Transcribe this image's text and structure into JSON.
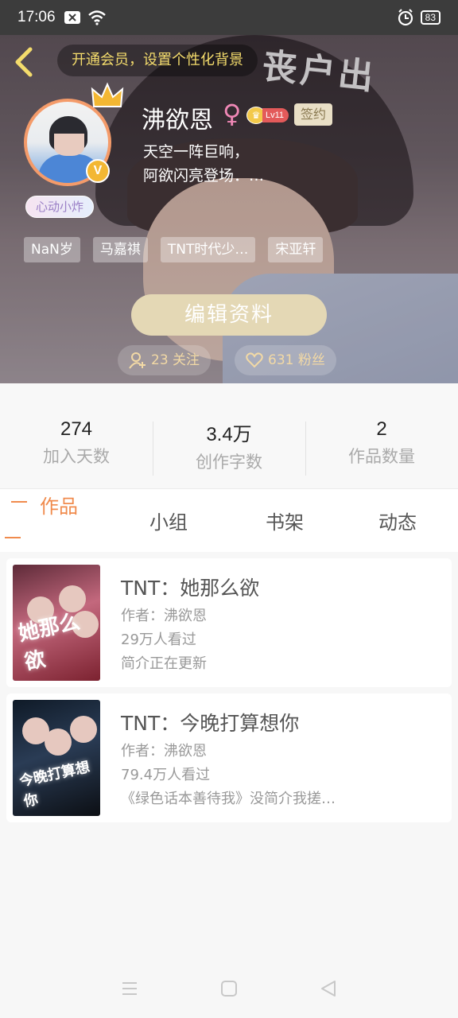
{
  "status_bar": {
    "time": "17:06",
    "battery": "83"
  },
  "profile": {
    "vip_banner": "开通会员，设置个性化背景",
    "username": "沸欲恩",
    "gender": "♀",
    "level": "Lv11",
    "sign_badge": "签约",
    "bio_line1": "天空一阵巨响，",
    "bio_line2": "阿欲闪亮登场．…",
    "status_sticker": "心动小炸",
    "verify_mark": "V",
    "tags": [
      "NaN岁",
      "马嘉祺",
      "TNT时代少…",
      "宋亚轩"
    ],
    "edit_label": "编辑资料",
    "following": "23 关注",
    "fans": "631 粉丝"
  },
  "stats": [
    {
      "value": "274",
      "label": "加入天数"
    },
    {
      "value": "3.4万",
      "label": "创作字数"
    },
    {
      "value": "2",
      "label": "作品数量"
    }
  ],
  "tabs": [
    "作品",
    "小组",
    "书架",
    "动态"
  ],
  "works": [
    {
      "title": "TNT：她那么欲",
      "author": "作者：沸欲恩",
      "views": "29万人看过",
      "desc": "简介正在更新",
      "cover_text": "她那么欲"
    },
    {
      "title": "TNT：今晚打算想你",
      "author": "作者：沸欲恩",
      "views": "79.4万人看过",
      "desc": "《绿色话本善待我》没简介我搓…",
      "cover_text": "今晚打算想你"
    }
  ],
  "colors": {
    "accent": "#f08b4d",
    "gold": "#f4dc6c",
    "edit_button": "#e4d8b5"
  }
}
